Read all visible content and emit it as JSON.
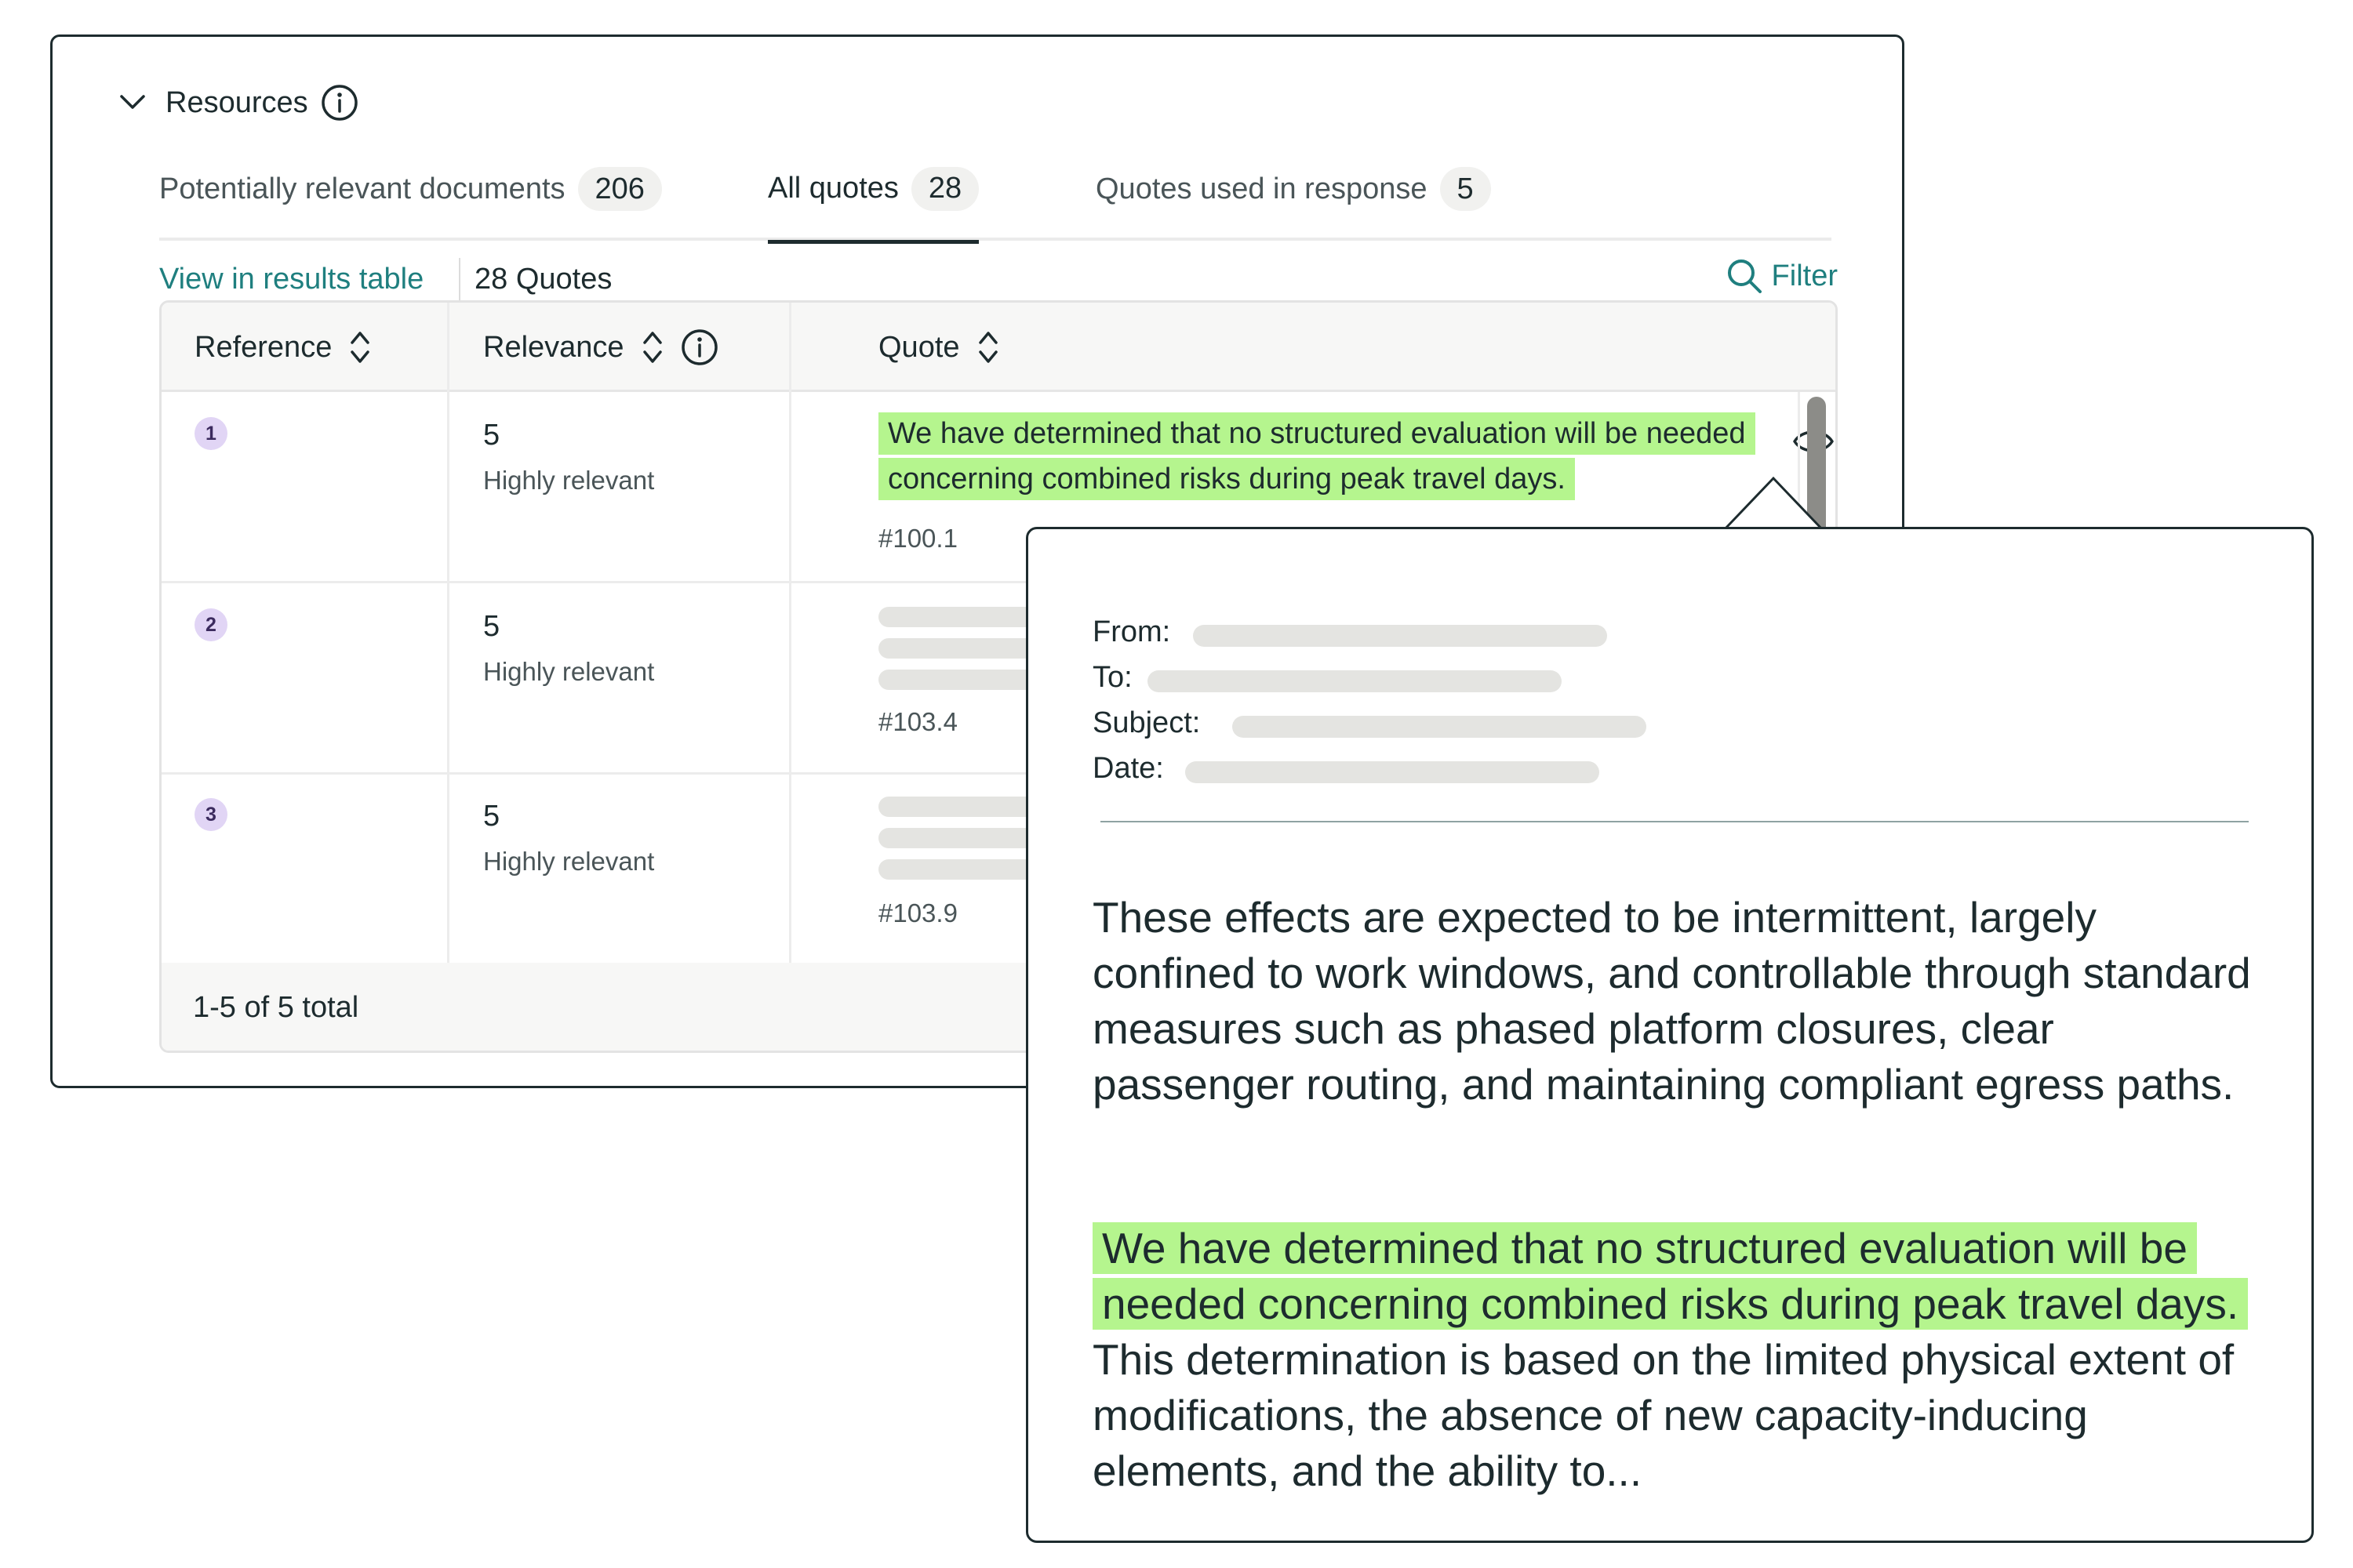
{
  "resources": {
    "title": "Resources"
  },
  "tabs": [
    {
      "label": "Potentially relevant documents",
      "count": "206"
    },
    {
      "label": "All quotes",
      "count": "28"
    },
    {
      "label": "Quotes used in response",
      "count": "5"
    }
  ],
  "toolbar": {
    "view_link": "View in results table",
    "quote_count": "28 Quotes",
    "filter_label": "Filter"
  },
  "table": {
    "columns": [
      "Reference",
      "Relevance",
      "Quote"
    ],
    "rows": [
      {
        "ref": "1",
        "relevance": "5",
        "relevance_label": "Highly relevant",
        "quote": "We have determined that no structured evaluation will be needed concerning combined risks during peak travel days.",
        "quote_ref": "#100.1"
      },
      {
        "ref": "2",
        "relevance": "5",
        "relevance_label": "Highly relevant",
        "quote": "",
        "quote_ref": "#103.4"
      },
      {
        "ref": "3",
        "relevance": "5",
        "relevance_label": "Highly relevant",
        "quote": "",
        "quote_ref": "#103.9"
      }
    ],
    "pager": "1-5 of 5 total"
  },
  "popover": {
    "meta_labels": {
      "from": "From:",
      "to": "To:",
      "subject": "Subject:",
      "date": "Date:"
    },
    "paragraph1": "These effects are expected to be intermittent, largely confined to work windows, and controllable through standard measures such as phased platform closures, clear passenger routing, and maintaining compliant egress paths.",
    "highlight": "We have determined that no structured evaluation will be needed concerning combined risks during peak travel days.",
    "paragraph2_rest": " This determination is based on the limited physical extent of modifications, the absence of new capacity-inducing elements, and the ability to..."
  },
  "colors": {
    "accent": "#1f7f7f",
    "highlight": "#b5f58e",
    "ref_badge": "#e1d5f5",
    "border": "#1d2b2e"
  }
}
